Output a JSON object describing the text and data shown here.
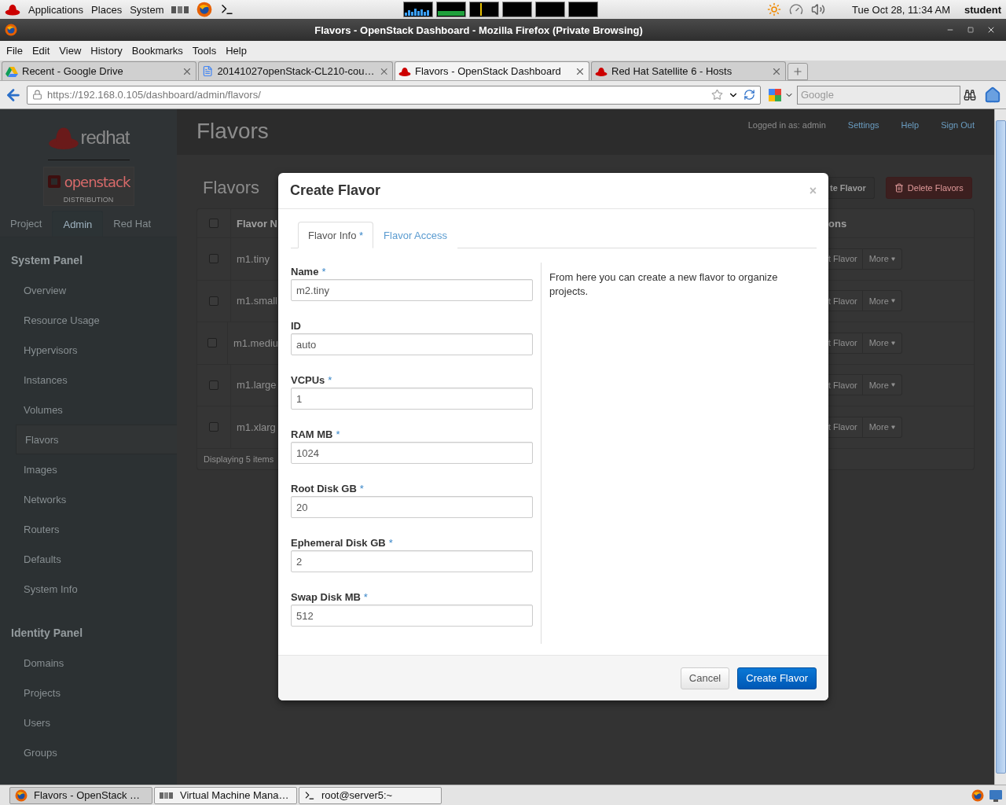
{
  "top_panel": {
    "menus": [
      "Applications",
      "Places",
      "System"
    ],
    "clock": "Tue Oct 28, 11:34 AM",
    "user": "student"
  },
  "window": {
    "title": "Flavors - OpenStack Dashboard - Mozilla Firefox (Private Browsing)"
  },
  "menu_bar": [
    "File",
    "Edit",
    "View",
    "History",
    "Bookmarks",
    "Tools",
    "Help"
  ],
  "browser_tabs": [
    {
      "label": "Recent - Google Drive",
      "kind": "drive",
      "selected": false
    },
    {
      "label": "20141027openStack-CL210-cou…",
      "kind": "doc",
      "selected": false
    },
    {
      "label": "Flavors - OpenStack Dashboard",
      "kind": "redhat",
      "selected": true
    },
    {
      "label": "Red Hat Satellite 6 - Hosts",
      "kind": "redhat",
      "selected": false
    }
  ],
  "address_bar": {
    "url": "https://192.168.0.105/dashboard/admin/flavors/",
    "search_placeholder": "Google"
  },
  "sidebar": {
    "logo_text": "redhat",
    "brand": "openstack",
    "brand_sub": "DISTRIBUTION",
    "tabs": [
      {
        "label": "Project",
        "selected": false
      },
      {
        "label": "Admin",
        "selected": true
      },
      {
        "label": "Red Hat",
        "selected": false
      }
    ],
    "sections": [
      {
        "title": "System Panel",
        "items": [
          {
            "label": "Overview",
            "selected": false
          },
          {
            "label": "Resource Usage",
            "selected": false
          },
          {
            "label": "Hypervisors",
            "selected": false
          },
          {
            "label": "Instances",
            "selected": false
          },
          {
            "label": "Volumes",
            "selected": false
          },
          {
            "label": "Flavors",
            "selected": true
          },
          {
            "label": "Images",
            "selected": false
          },
          {
            "label": "Networks",
            "selected": false
          },
          {
            "label": "Routers",
            "selected": false
          },
          {
            "label": "Defaults",
            "selected": false
          },
          {
            "label": "System Info",
            "selected": false
          }
        ]
      },
      {
        "title": "Identity Panel",
        "items": [
          {
            "label": "Domains",
            "selected": false
          },
          {
            "label": "Projects",
            "selected": false
          },
          {
            "label": "Users",
            "selected": false
          },
          {
            "label": "Groups",
            "selected": false
          }
        ]
      }
    ]
  },
  "header": {
    "title": "Flavors",
    "user": "Logged in as: admin",
    "links": [
      "Settings",
      "Help",
      "Sign Out"
    ]
  },
  "page": {
    "heading": "Flavors",
    "actions": [
      {
        "label": "te Flavor",
        "kind": "default"
      },
      {
        "label": "Delete Flavors",
        "kind": "danger"
      }
    ],
    "table": {
      "select_all_checked": false,
      "columns": [
        "Flavor N",
        "ons"
      ],
      "rows": [
        {
          "name": "m1.tiny",
          "checked": false,
          "action": "t Flavor",
          "more": "More"
        },
        {
          "name": "m1.small",
          "checked": false,
          "action": "t Flavor",
          "more": "More"
        },
        {
          "name": "m1.mediu",
          "checked": false,
          "action": "t Flavor",
          "more": "More"
        },
        {
          "name": "m1.large",
          "checked": false,
          "action": "t Flavor",
          "more": "More"
        },
        {
          "name": "m1.xlarg",
          "checked": false,
          "action": "t Flavor",
          "more": "More"
        }
      ],
      "footer": "Displaying 5 items"
    }
  },
  "modal": {
    "title": "Create Flavor",
    "close": "×",
    "required_mark": "*",
    "tabs": [
      {
        "label": "Flavor Info",
        "required": true,
        "selected": true
      },
      {
        "label": "Flavor Access",
        "required": false,
        "selected": false
      }
    ],
    "fields": [
      {
        "label": "Name",
        "required": true,
        "value": "m2.tiny"
      },
      {
        "label": "ID",
        "required": false,
        "value": "auto"
      },
      {
        "label": "VCPUs",
        "required": true,
        "value": "1"
      },
      {
        "label": "RAM MB",
        "required": true,
        "value": "1024"
      },
      {
        "label": "Root Disk GB",
        "required": true,
        "value": "20"
      },
      {
        "label": "Ephemeral Disk GB",
        "required": true,
        "value": "2"
      },
      {
        "label": "Swap Disk MB",
        "required": true,
        "value": "512"
      }
    ],
    "help": "From here you can create a new flavor to organize projects.",
    "buttons": [
      {
        "label": "Cancel",
        "kind": "default"
      },
      {
        "label": "Create Flavor",
        "kind": "primary"
      }
    ]
  },
  "taskbar": [
    {
      "label": "Flavors - OpenStack …",
      "kind": "firefox",
      "selected": true
    },
    {
      "label": "Virtual Machine Mana…",
      "kind": "vm",
      "selected": false
    },
    {
      "label": "root@server5:~",
      "kind": "terminal",
      "selected": false
    }
  ]
}
